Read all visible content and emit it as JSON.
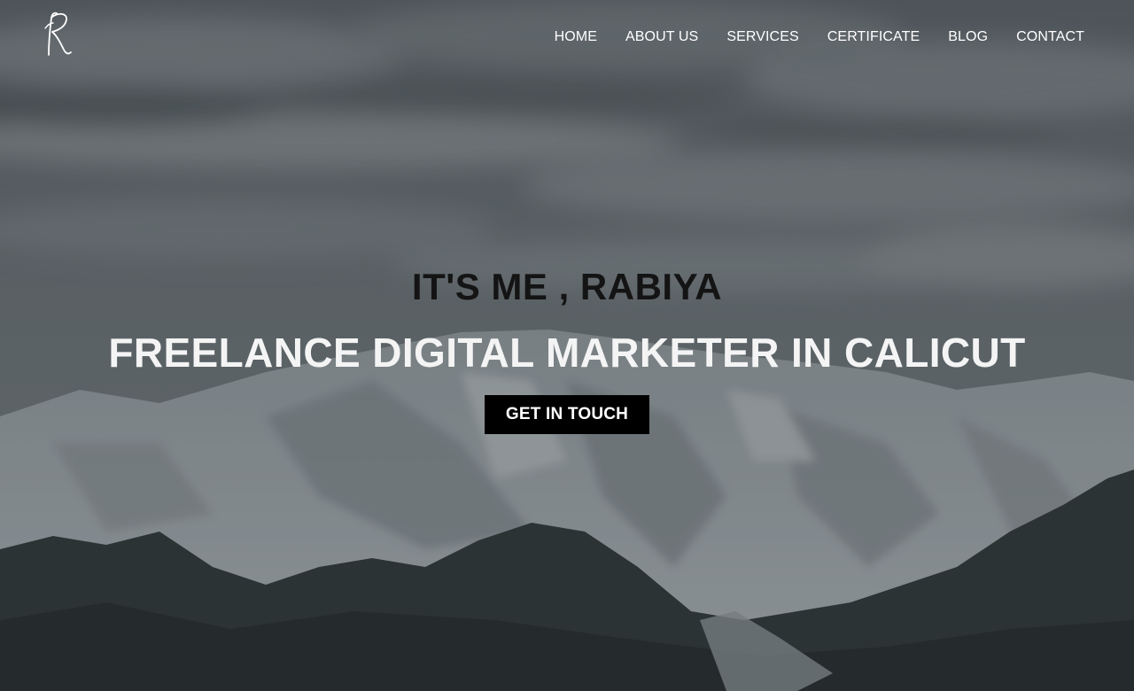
{
  "brand": {
    "logo_icon": "script-letter-r-logo"
  },
  "nav": {
    "items": [
      {
        "label": "HOME"
      },
      {
        "label": "ABOUT US"
      },
      {
        "label": "SERVICES"
      },
      {
        "label": "CERTIFICATE"
      },
      {
        "label": "BLOG"
      },
      {
        "label": "CONTACT"
      }
    ]
  },
  "hero": {
    "intro": "IT'S ME , RABIYA",
    "headline": "FREELANCE DIGITAL MARKETER IN CALICUT",
    "cta_label": "GET IN TOUCH",
    "background_image": "snowy-mountain-landscape",
    "colors": {
      "intro_text": "#141414",
      "headline_text": "#f4f4f4",
      "cta_background": "#000000",
      "cta_text": "#ffffff"
    }
  }
}
